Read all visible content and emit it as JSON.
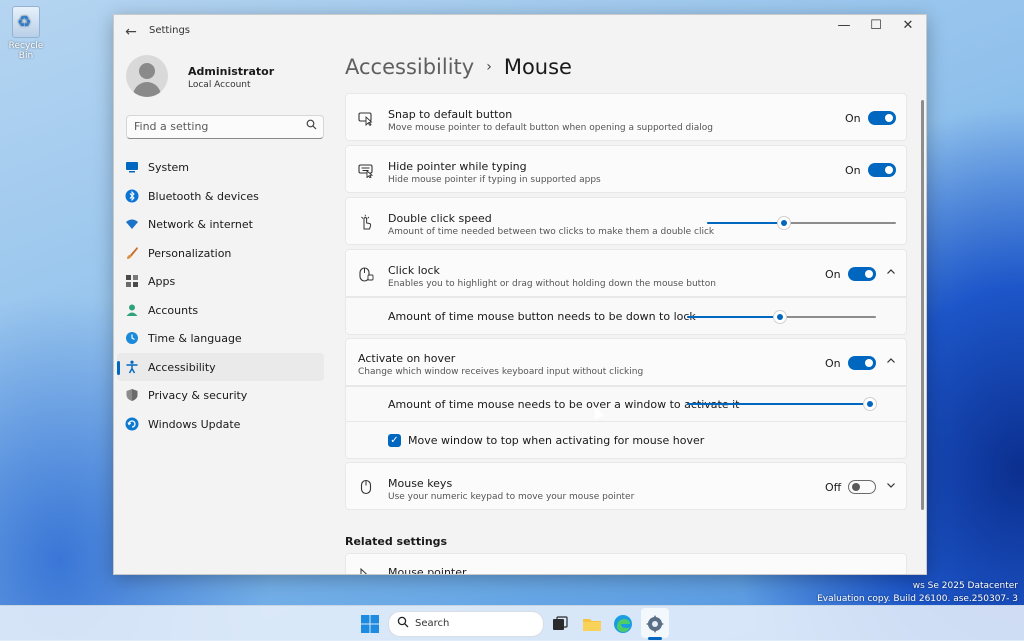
{
  "desktop": {
    "recycle_bin_label": "Recycle Bin",
    "watermark_line1": "ws Se    2025 Datacenter",
    "watermark_line2": "Evaluation copy. Build 26100.   ase.250307-   3"
  },
  "window": {
    "title": "Settings",
    "back_glyph": "←",
    "minimize_glyph": "—",
    "maximize_glyph": "☐",
    "close_glyph": "✕"
  },
  "profile": {
    "name": "Administrator",
    "account_type": "Local Account"
  },
  "search": {
    "placeholder": "Find a setting"
  },
  "nav": {
    "items": [
      {
        "label": "System",
        "color": "#0067c0"
      },
      {
        "label": "Bluetooth & devices",
        "color": "#0a74d4"
      },
      {
        "label": "Network & internet",
        "color": "#1a73c7"
      },
      {
        "label": "Personalization",
        "color": "#e06b3a"
      },
      {
        "label": "Apps",
        "color": "#4a4a4a"
      },
      {
        "label": "Accounts",
        "color": "#2ea37a"
      },
      {
        "label": "Time & language",
        "color": "#1a8ad9"
      },
      {
        "label": "Accessibility",
        "color": "#0067c0"
      },
      {
        "label": "Privacy & security",
        "color": "#707070"
      },
      {
        "label": "Windows Update",
        "color": "#0a79d0"
      }
    ],
    "active_index": 7
  },
  "breadcrumb": {
    "parent": "Accessibility",
    "separator": "›",
    "current": "Mouse"
  },
  "settings": {
    "snap": {
      "title": "Snap to default button",
      "description": "Move mouse pointer to default button when opening a supported dialog",
      "state": "On"
    },
    "hide_pointer": {
      "title": "Hide pointer while typing",
      "description": "Hide mouse pointer if typing in supported apps",
      "state": "On"
    },
    "double_click": {
      "title": "Double click speed",
      "description": "Amount of time needed between two clicks to make them a double click",
      "value_fraction": 0.41
    },
    "click_lock": {
      "title": "Click lock",
      "description": "Enables you to highlight or drag without holding down the mouse button",
      "state": "On",
      "sub_label": "Amount of time mouse button needs to be down to lock",
      "value_fraction": 0.49
    },
    "activate_hover": {
      "title": "Activate on hover",
      "description": "Change which window receives keyboard input without clicking",
      "state": "On",
      "sub_label": "Amount of time mouse needs to be over a window to activate it",
      "value_fraction": 0.97,
      "checkbox_label": "Move window to top when activating for mouse hover",
      "checkbox_glyph": "✓"
    },
    "mouse_keys": {
      "title": "Mouse keys",
      "description": "Use your numeric keypad to move your mouse pointer",
      "state": "Off"
    }
  },
  "related": {
    "heading": "Related settings",
    "first_item": "Mouse pointer"
  },
  "taskbar": {
    "search_label": "Search"
  },
  "accent_color": "#0067c0"
}
